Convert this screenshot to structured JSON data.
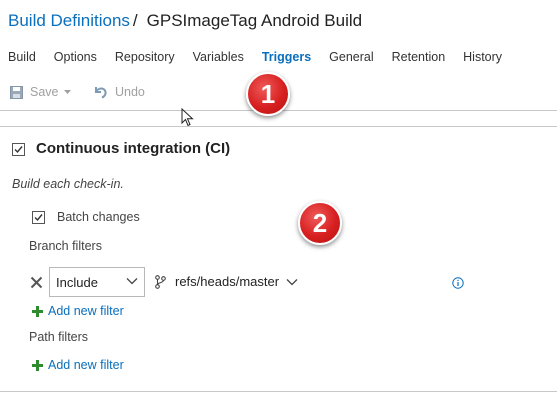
{
  "header": {
    "breadcrumb_link": "Build Definitions",
    "separator": "/",
    "title": "GPSImageTag Android Build"
  },
  "tabs": [
    {
      "label": "Build",
      "active": false
    },
    {
      "label": "Options",
      "active": false
    },
    {
      "label": "Repository",
      "active": false
    },
    {
      "label": "Variables",
      "active": false
    },
    {
      "label": "Triggers",
      "active": true
    },
    {
      "label": "General",
      "active": false
    },
    {
      "label": "Retention",
      "active": false
    },
    {
      "label": "History",
      "active": false
    }
  ],
  "toolbar": {
    "save_label": "Save",
    "undo_label": "Undo",
    "save_icon": "floppy-disk-icon",
    "undo_icon": "undo-icon"
  },
  "callouts": {
    "one": "1",
    "two": "2"
  },
  "ci": {
    "checked": true,
    "heading": "Continuous integration (CI)",
    "description": "Build each check-in.",
    "batch_changes_label": "Batch changes",
    "batch_changes_checked": true,
    "branch_filters_label": "Branch filters",
    "filter": {
      "type": "Include",
      "branch": "refs/heads/master"
    },
    "add_branch_filter_label": "Add new filter",
    "path_filters_label": "Path filters",
    "add_path_filter_label": "Add new filter"
  },
  "colors": {
    "accent": "#0a6fbd",
    "add_green": "#2e8b2e",
    "callout_red": "#d72020"
  }
}
